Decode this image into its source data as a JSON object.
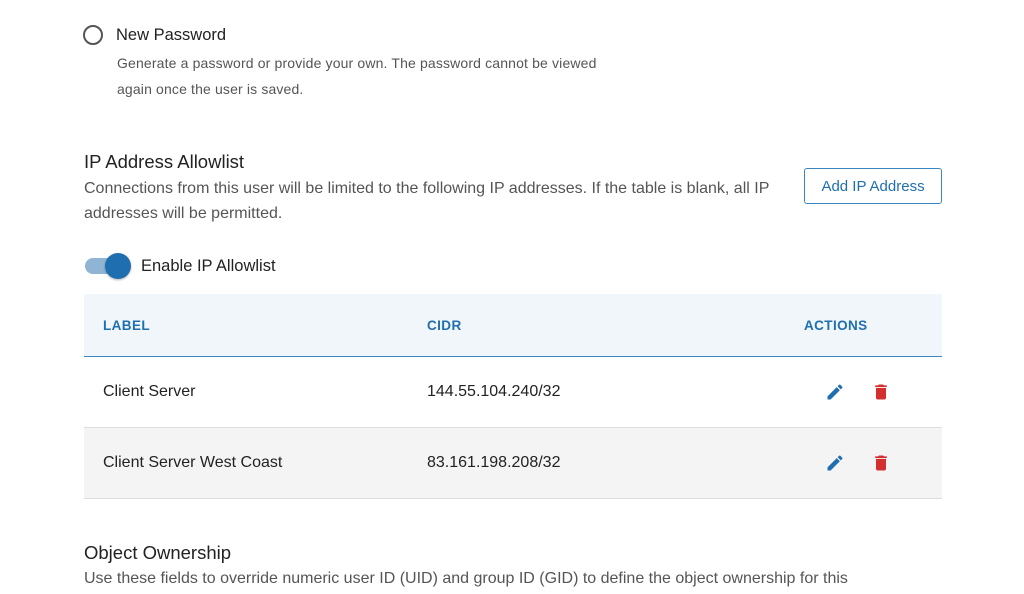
{
  "password_option": {
    "label": "New Password",
    "help_line1": "Generate a password or provide your own. The password cannot be viewed",
    "help_line2": "again once the user is saved."
  },
  "ip_allowlist": {
    "title": "IP Address Allowlist",
    "description": "Connections from this user will be limited to the following IP addresses. If the table is blank, all IP addresses will be permitted.",
    "add_button": "Add IP Address",
    "toggle_label": "Enable IP Allowlist",
    "toggle_on": true,
    "table": {
      "columns": [
        "LABEL",
        "CIDR",
        "ACTIONS"
      ],
      "rows": [
        {
          "label": "Client Server",
          "cidr": "144.55.104.240/32"
        },
        {
          "label": "Client Server West Coast",
          "cidr": "83.161.198.208/32"
        }
      ],
      "row_icons": [
        "pencil-icon",
        "trash-icon"
      ]
    }
  },
  "object_ownership": {
    "title": "Object Ownership",
    "description": "Use these fields to override numeric user ID (UID) and group ID (GID) to define the object ownership for this"
  },
  "colors": {
    "accent": "#1f6fb0",
    "delete": "#d32f2f",
    "header_bg": "#f1f6fb",
    "alt_row_bg": "#f4f4f4"
  }
}
